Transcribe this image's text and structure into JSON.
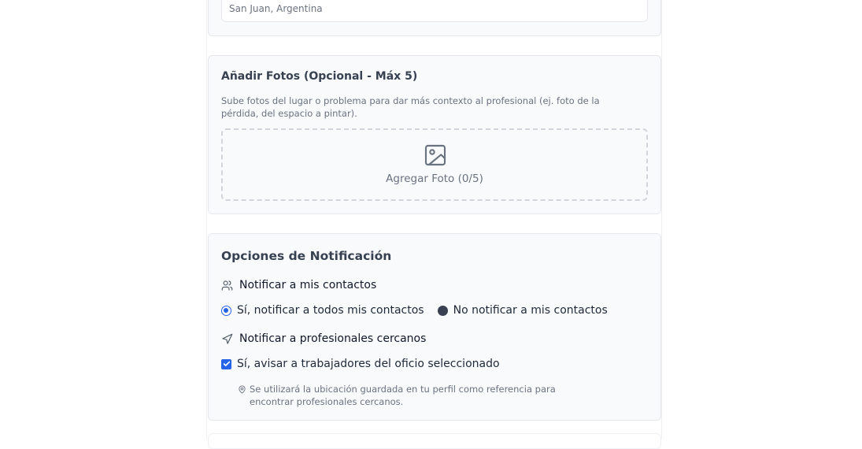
{
  "location": {
    "value": "San Juan, Argentina"
  },
  "photos": {
    "title": "Añadir Fotos (Opcional - Máx 5)",
    "description": "Sube fotos del lugar o problema para dar más contexto al profesional (ej. foto de la pérdida, del espacio a pintar).",
    "add_label": "Agregar Foto (0/5)",
    "icon": "image-icon"
  },
  "notifications": {
    "title": "Opciones de Notificación",
    "contacts": {
      "title": "Notificar a mis contactos",
      "icon": "users-icon",
      "options": [
        {
          "label": "Sí, notificar a todos mis contactos",
          "selected": true
        },
        {
          "label": "No notificar a mis contactos",
          "selected": false
        }
      ]
    },
    "professionals": {
      "title": "Notificar a profesionales cercanos",
      "icon": "send-icon",
      "checkbox_label": "Sí, avisar a trabajadores del oficio seleccionado",
      "checked": true,
      "note": "Se utilizará la ubicación guardada en tu perfil como referencia para encontrar profesionales cercanos.",
      "note_icon": "map-pin-icon"
    }
  },
  "colors": {
    "accent": "#2563eb",
    "card_bg": "#f8fafc",
    "border": "#e5e7eb",
    "muted_text": "#6b7280"
  }
}
